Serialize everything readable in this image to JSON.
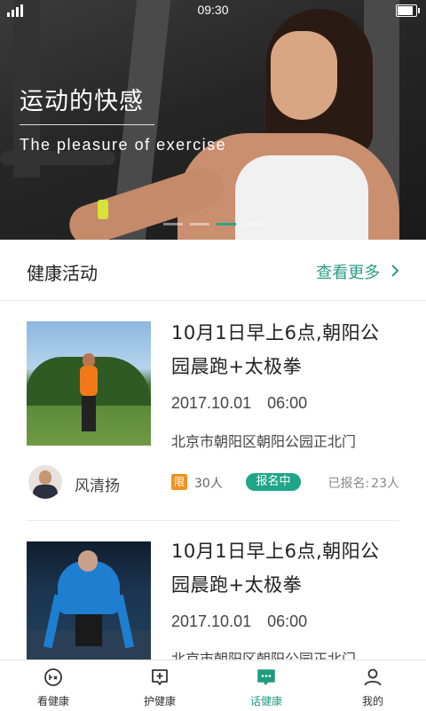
{
  "status_bar": {
    "time": "09:30"
  },
  "banner": {
    "title": "运动的快感",
    "subtitle": "The pleasure of exercise",
    "slide_count": 4,
    "active_slide": 3
  },
  "section": {
    "title": "健康活动",
    "more_label": "查看更多"
  },
  "activities": [
    {
      "title_line1": "10月1日早上6点,朝阳公",
      "title_line2": "园晨跑+太极拳",
      "date": "2017.10.01",
      "time": "06:00",
      "location": "北京市朝阳区朝阳公园正北门",
      "author": "风清扬",
      "limit_badge": "限",
      "limit_count": "30人",
      "status": "报名中",
      "enrolled_label": "已报名:",
      "enrolled_count": "23人"
    },
    {
      "title_line1": "10月1日早上6点,朝阳公",
      "title_line2": "园晨跑+太极拳",
      "date": "2017.10.01",
      "time": "06:00",
      "location": "北京市朝阳区朝阳公园正北门"
    }
  ],
  "nav": {
    "items": [
      {
        "label": "看健康",
        "icon": "watch-health-icon"
      },
      {
        "label": "护健康",
        "icon": "medical-plus-icon"
      },
      {
        "label": "话健康",
        "icon": "chat-bubble-icon",
        "active": true
      },
      {
        "label": "我的",
        "icon": "user-profile-icon"
      }
    ]
  },
  "colors": {
    "accent": "#1fa587",
    "limit_badge": "#f29020",
    "text": "#222222"
  }
}
